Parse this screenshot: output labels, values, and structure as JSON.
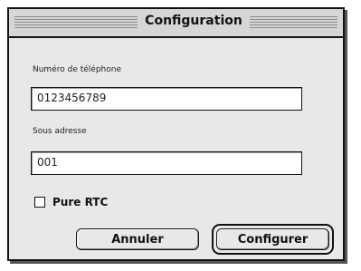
{
  "dialog": {
    "title": "Configuration",
    "phone": {
      "label": "Numéro de téléphone",
      "value": "0123456789"
    },
    "subaddress": {
      "label": "Sous adresse",
      "value": "001"
    },
    "pure_rtc": {
      "label": "Pure RTC",
      "checked": false
    },
    "buttons": {
      "cancel": "Annuler",
      "configure": "Configurer"
    }
  }
}
